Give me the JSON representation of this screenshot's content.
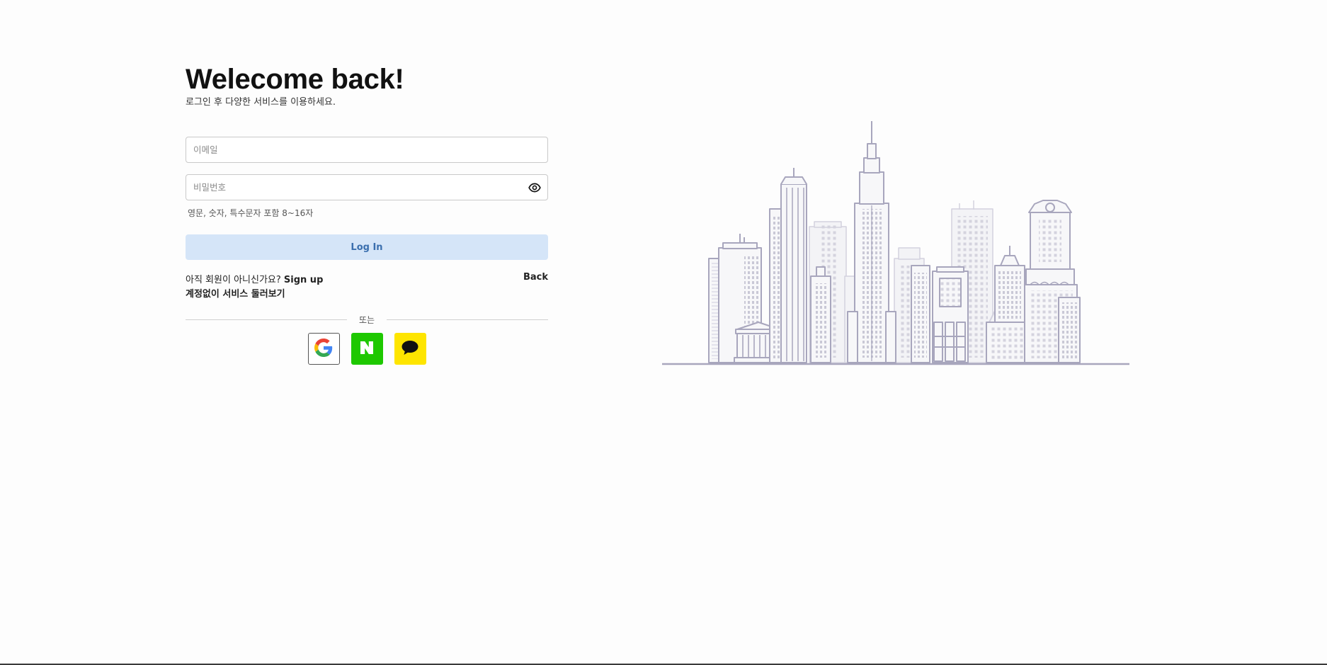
{
  "header": {
    "title": "Welecome back!",
    "subtitle": "로그인 후 다양한 서비스를 이용하세요."
  },
  "form": {
    "email_placeholder": "이메일",
    "email_value": "",
    "password_placeholder": "비밀번호",
    "password_value": "",
    "password_hint": "영문, 숫자, 특수문자 포함 8~16자",
    "login_label": "Log In"
  },
  "links": {
    "signup_prompt": "아직 회원이 아니신가요? ",
    "signup_label": "Sign up",
    "back_label": "Back",
    "guest_label": "계정없이 서비스 둘러보기"
  },
  "divider": {
    "text": "또는"
  },
  "social": {
    "google_icon": "google-icon",
    "naver_icon": "naver-icon",
    "kakao_icon": "kakao-talk-icon"
  },
  "illustration": {
    "name": "city-skyline-illustration"
  },
  "colors": {
    "login_button_bg": "#d5e5f8",
    "login_button_text": "#3b6fae",
    "naver_green": "#1ec800",
    "kakao_yellow": "#fee500",
    "skyline_stroke": "#a8a6bd"
  }
}
